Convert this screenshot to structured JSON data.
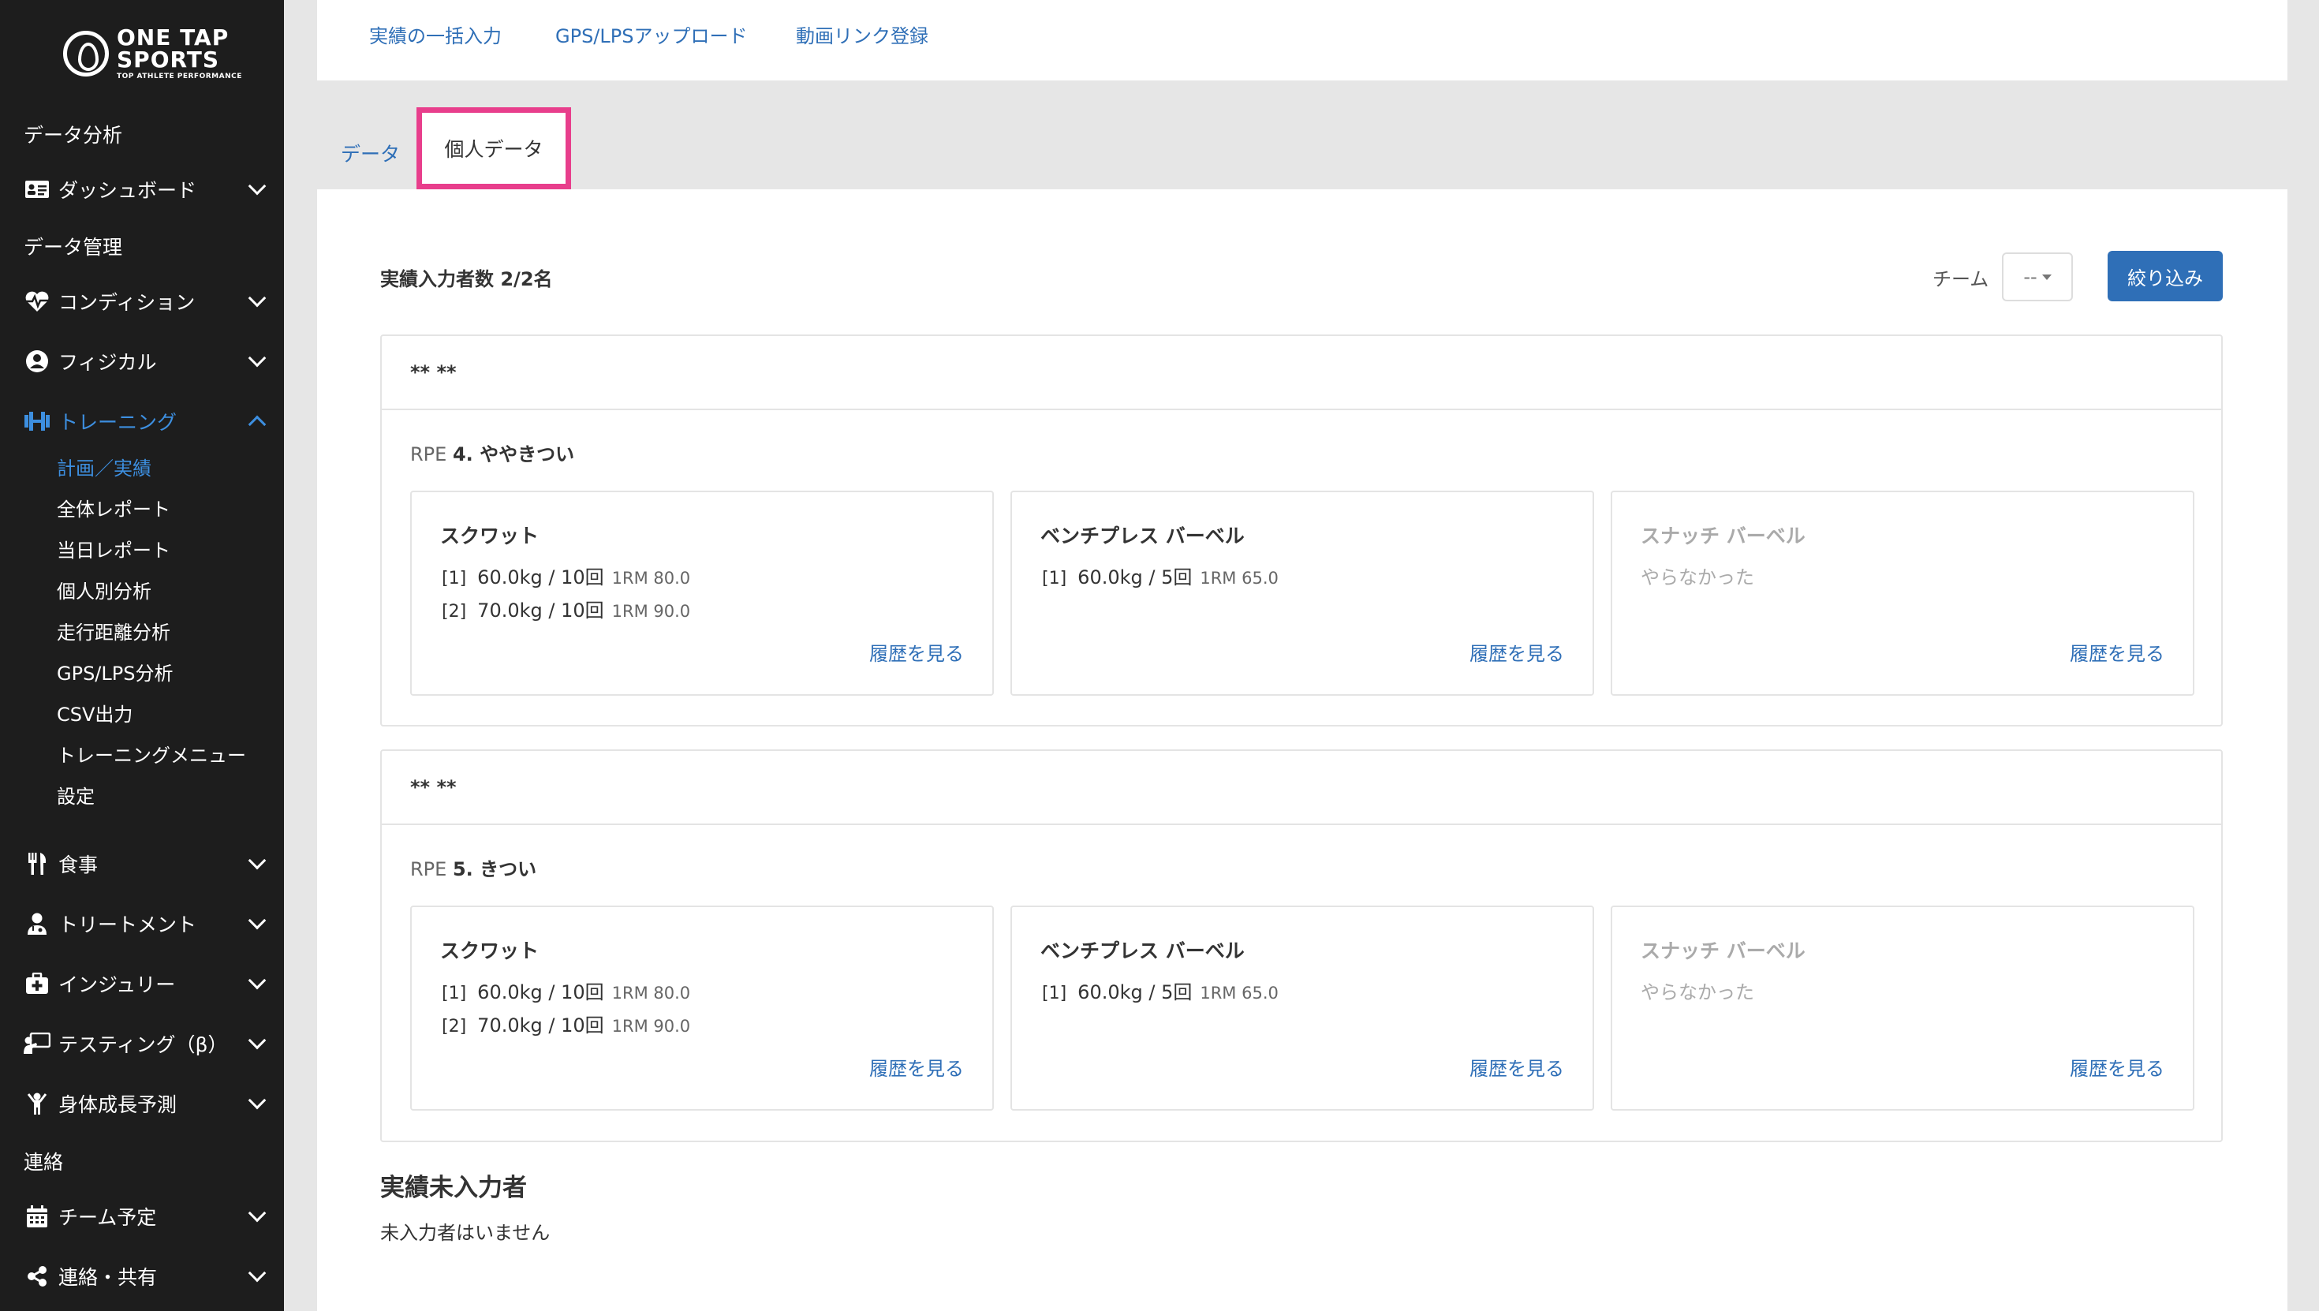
{
  "sidebar": {
    "logo": {
      "line1": "ONE TAP",
      "line2": "SPORTS",
      "line3": "TOP ATHLETE PERFORMANCE"
    },
    "sections": {
      "analysis": "データ分析",
      "management": "データ管理",
      "contact": "連絡"
    },
    "items": {
      "dashboard": "ダッシュボード",
      "condition": "コンディション",
      "physical": "フィジカル",
      "training": "トレーニング",
      "meal": "食事",
      "treatment": "トリートメント",
      "injury": "インジュリー",
      "testing": "テスティング（β）",
      "growth": "身体成長予測",
      "schedule": "チーム予定",
      "share": "連絡・共有"
    },
    "training_sub": [
      "計画／実績",
      "全体レポート",
      "当日レポート",
      "個人別分析",
      "走行距離分析",
      "GPS/LPS分析",
      "CSV出力",
      "トレーニングメニュー",
      "設定"
    ]
  },
  "topbar": {
    "links": [
      "実績の一括入力",
      "GPS/LPSアップロード",
      "動画リンク登録"
    ]
  },
  "tabs": {
    "data": "データ",
    "personal": "個人データ"
  },
  "summary": {
    "count": "実績入力者数 2/2名",
    "team_label": "チーム",
    "team_value": "--",
    "filter_button": "絞り込み"
  },
  "players": [
    {
      "name": "** **",
      "rpe_prefix": "RPE",
      "rpe_value": "4. ややきつい",
      "exercises": [
        {
          "name": "スクワット",
          "sets": [
            {
              "idx": "[1]",
              "value": "60.0kg / 10回",
              "rm": "1RM 80.0"
            },
            {
              "idx": "[2]",
              "value": "70.0kg / 10回",
              "rm": "1RM 90.0"
            }
          ],
          "history": "履歴を見る"
        },
        {
          "name": "ベンチプレス バーベル",
          "sets": [
            {
              "idx": "[1]",
              "value": "60.0kg / 5回",
              "rm": "1RM 65.0"
            }
          ],
          "history": "履歴を見る"
        },
        {
          "name": "スナッチ バーベル",
          "none": "やらなかった",
          "history": "履歴を見る"
        }
      ]
    },
    {
      "name": "** **",
      "rpe_prefix": "RPE",
      "rpe_value": "5. きつい",
      "exercises": [
        {
          "name": "スクワット",
          "sets": [
            {
              "idx": "[1]",
              "value": "60.0kg / 10回",
              "rm": "1RM 80.0"
            },
            {
              "idx": "[2]",
              "value": "70.0kg / 10回",
              "rm": "1RM 90.0"
            }
          ],
          "history": "履歴を見る"
        },
        {
          "name": "ベンチプレス バーベル",
          "sets": [
            {
              "idx": "[1]",
              "value": "60.0kg / 5回",
              "rm": "1RM 65.0"
            }
          ],
          "history": "履歴を見る"
        },
        {
          "name": "スナッチ バーベル",
          "none": "やらなかった",
          "history": "履歴を見る"
        }
      ]
    }
  ],
  "non_entry": {
    "title": "実績未入力者",
    "text": "未入力者はいません"
  }
}
